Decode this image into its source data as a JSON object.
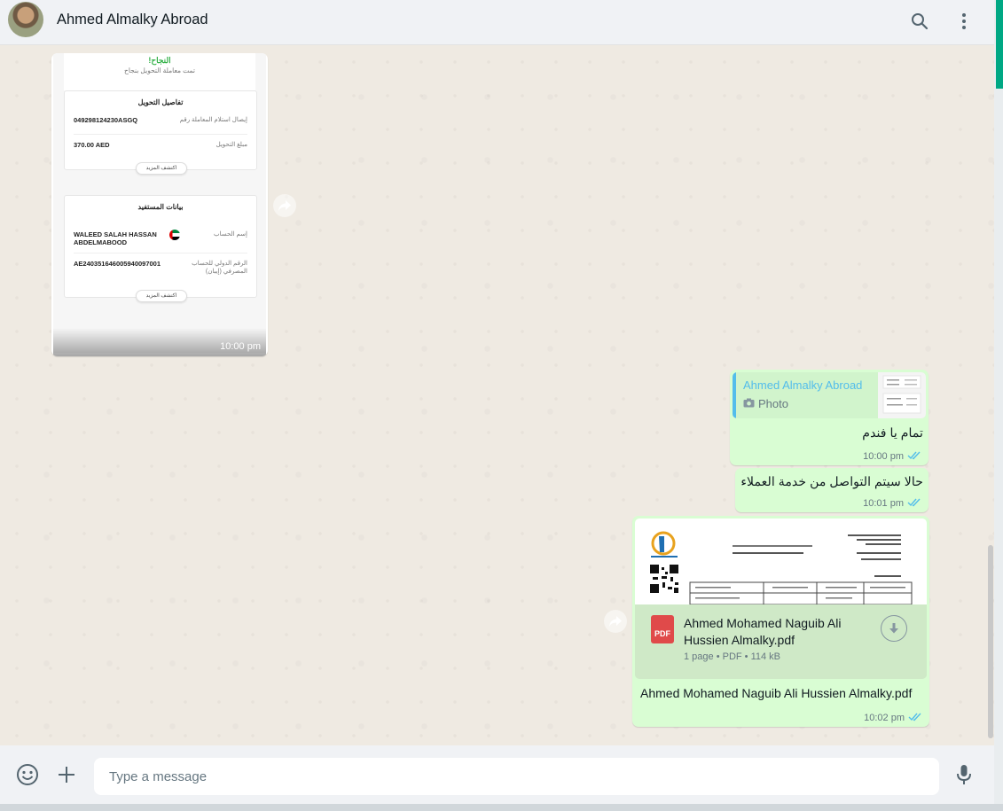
{
  "header": {
    "contact_name": "Ahmed Almalky Abroad",
    "icons": [
      "search-icon",
      "menu-icon"
    ]
  },
  "messages": {
    "incoming_image": {
      "time": "10:00 pm",
      "receipt": {
        "success_title": "النجاح!",
        "success_subtitle": "تمت معاملة التحويل بنجاح",
        "transfer_card": {
          "title": "تفاصيل التحويل",
          "rows": [
            {
              "label": "إيصال استلام المعاملة رقم",
              "value": "049298124230ASGQ"
            },
            {
              "label": "مبلغ التحويل",
              "value": "370.00 AED"
            }
          ],
          "more": "اكتشف المزيد"
        },
        "beneficiary_card": {
          "title": "بيانات المستفيد",
          "rows": [
            {
              "label": "إسم الحساب",
              "value": "WALEED SALAH HASSAN ABDELMABOOD"
            },
            {
              "label": "الرقم الدولي للحساب المصرفي (إيبان)",
              "value": "AE240351646005940097001"
            }
          ],
          "more": "اكتشف المزيد"
        }
      }
    },
    "reply": {
      "quoted_name": "Ahmed Almalky Abroad",
      "quoted_type": "Photo",
      "text": "تمام يا فندم",
      "time": "10:00 pm"
    },
    "text_msg": {
      "text": "حالا سيتم التواصل من خدمة العملاء",
      "time": "10:01 pm"
    },
    "document": {
      "file_name": "Ahmed Mohamed Naguib Ali Hussien Almalky.pdf",
      "file_icon_label": "PDF",
      "file_meta": "1 page • PDF • 114 kB",
      "caption": "Ahmed Mohamed Naguib Ali Hussien Almalky.pdf",
      "time": "10:02 pm"
    }
  },
  "composer": {
    "placeholder": "Type a message",
    "icons": [
      "emoji-icon",
      "plus-icon",
      "microphone-icon"
    ]
  },
  "colors": {
    "outgoing_bubble": "#d9fdd3",
    "chat_background": "#efeae2",
    "read_tick": "#53bdeb",
    "accent": "#00a884"
  }
}
